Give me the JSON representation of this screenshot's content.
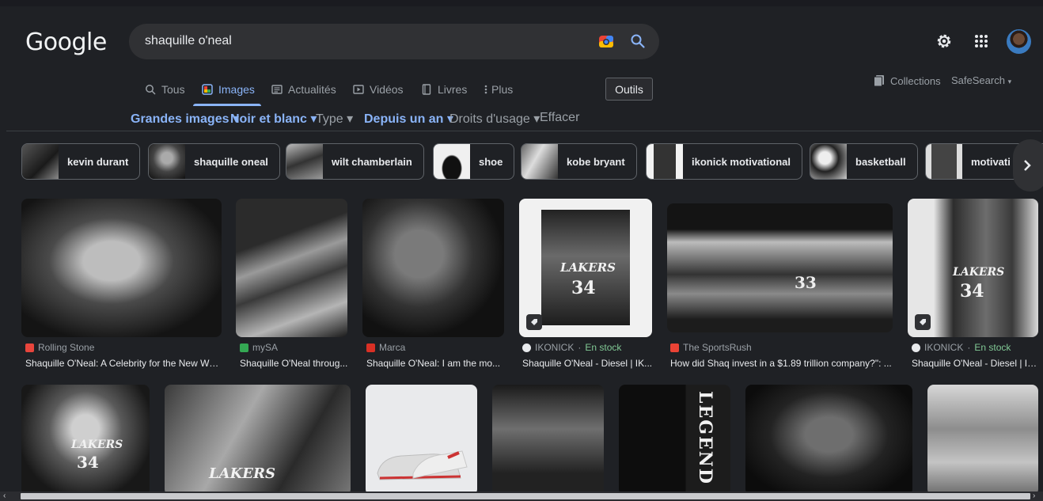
{
  "logo": "Google",
  "search": {
    "query": "shaquille o'neal"
  },
  "tabs": [
    {
      "label": "Tous",
      "icon": "search-icon"
    },
    {
      "label": "Images",
      "icon": "images-icon",
      "active": true
    },
    {
      "label": "Actualités",
      "icon": "news-icon"
    },
    {
      "label": "Vidéos",
      "icon": "video-icon"
    },
    {
      "label": "Livres",
      "icon": "book-icon"
    },
    {
      "label": "Plus",
      "icon": "more-vert-icon"
    }
  ],
  "tools_label": "Outils",
  "collections_label": "Collections",
  "safesearch_label": "SafeSearch",
  "filters": [
    {
      "label": "Grandes images",
      "active": true
    },
    {
      "label": "Noir et blanc",
      "active": true
    },
    {
      "label": "Type",
      "active": false
    },
    {
      "label": "Depuis un an",
      "active": true
    },
    {
      "label": "Droits d'usage",
      "active": false
    },
    {
      "label": "Effacer",
      "active": false
    }
  ],
  "chips": [
    "kevin durant",
    "shaquille oneal",
    "wilt chamberlain",
    "shoe",
    "kobe bryant",
    "ikonick motivational",
    "basketball",
    "motivati"
  ],
  "results_row1": [
    {
      "source": "Rolling Stone",
      "title": "Shaquille O'Neal: A Celebrity for the New Wo...",
      "fav_color": "#e8453c"
    },
    {
      "source": "mySA",
      "title": "Shaquille O'Neal throug...",
      "fav_color": "#34a853"
    },
    {
      "source": "Marca",
      "title": "Shaquille O'Neal: I am the mo...",
      "fav_color": "#d93025"
    },
    {
      "source": "IKONICK",
      "instock": "En stock",
      "title": "Shaquille O'Neal - Diesel | IK...",
      "fav_color": "#e8eaed"
    },
    {
      "source": "The SportsRush",
      "title": "How did Shaq invest in a $1.89 trillion company?\": ...",
      "fav_color": "#ea4335"
    },
    {
      "source": "IKONICK",
      "instock": "En stock",
      "title": "Shaquille O'Neal - Diesel | IK...",
      "fav_color": "#e8eaed"
    }
  ],
  "jersey": {
    "team": "LAKERS",
    "number": "34",
    "team2": "LEGEND"
  }
}
